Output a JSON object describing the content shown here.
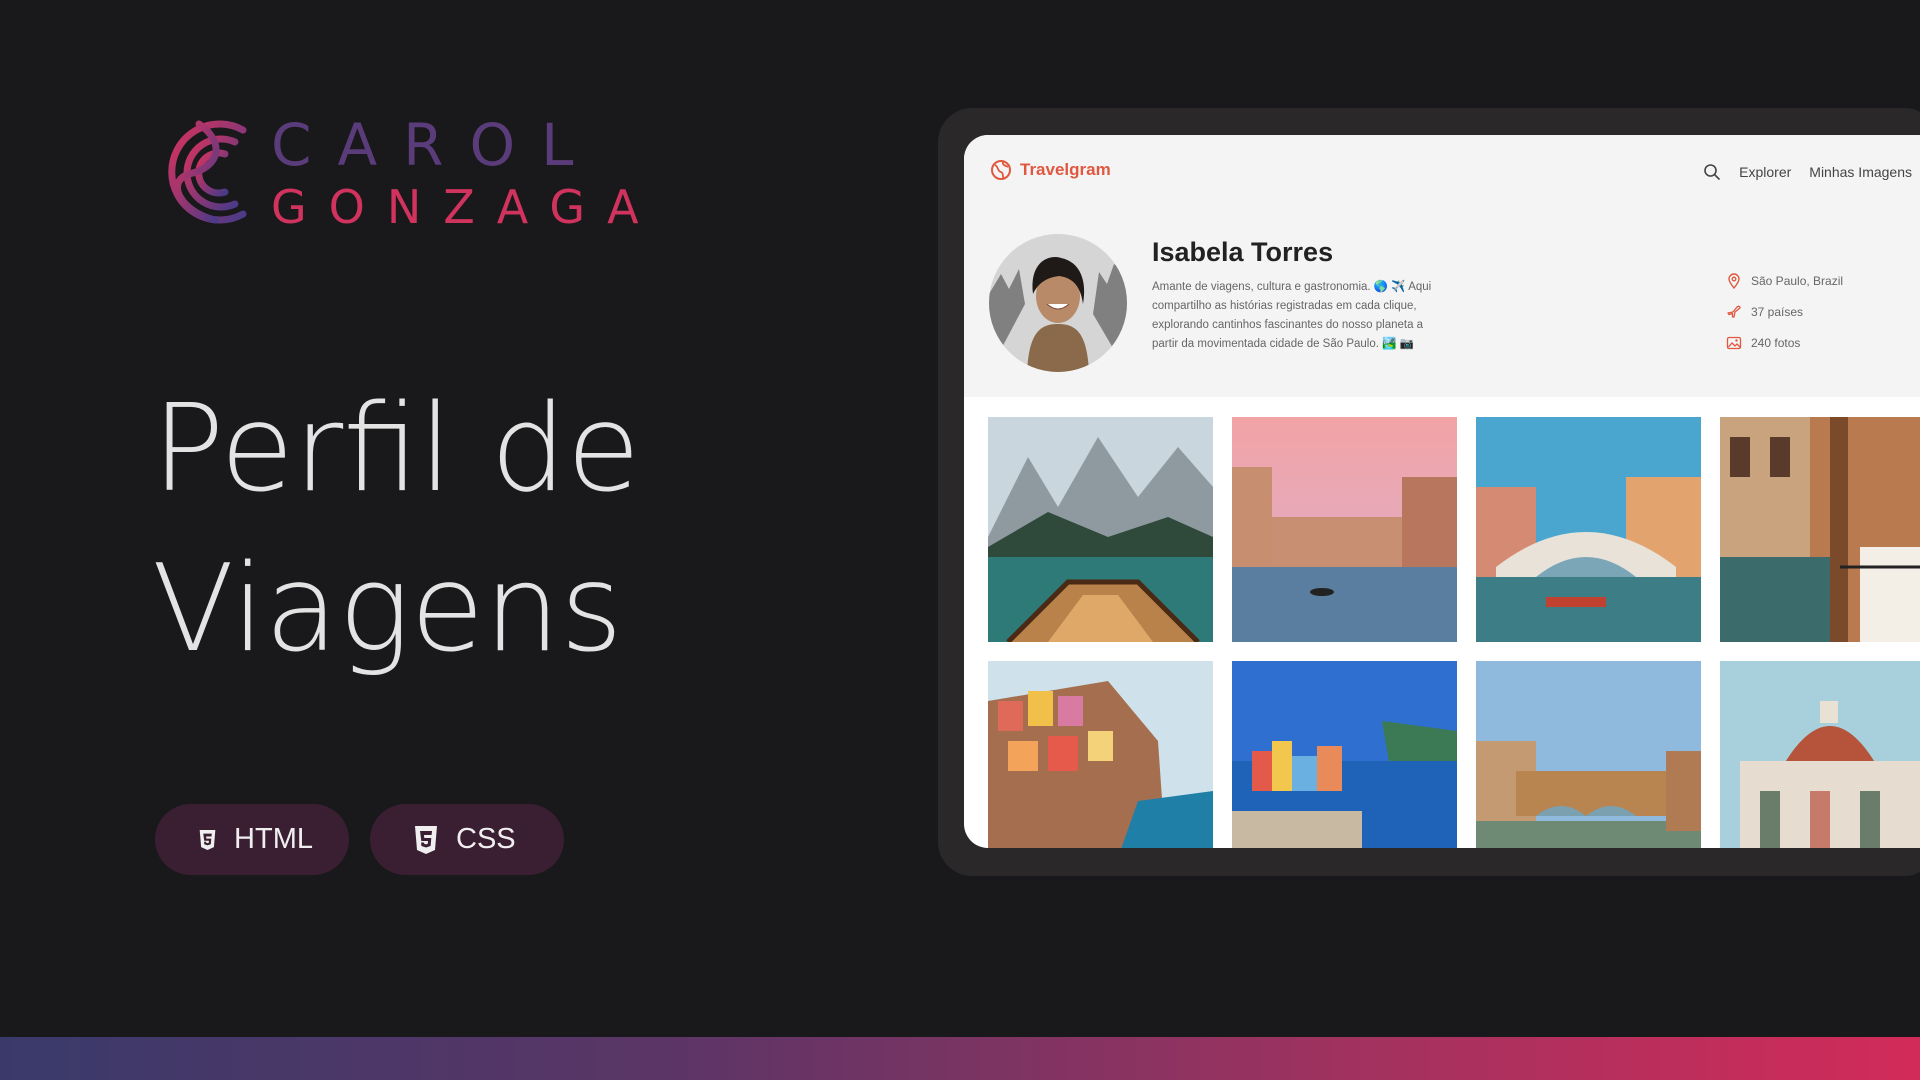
{
  "logo": {
    "line1": "CAROL",
    "line2": "GONZAGA"
  },
  "headline": {
    "line1": "Perfil de",
    "line2": "Viagens"
  },
  "tags": [
    {
      "label": "HTML",
      "icon": "html5-icon"
    },
    {
      "label": "CSS",
      "icon": "css3-icon"
    }
  ],
  "mockup": {
    "brand": "Travelgram",
    "nav": {
      "explore": "Explorer",
      "my_images": "Minhas Imagens"
    },
    "profile": {
      "name": "Isabela Torres",
      "bio": "Amante de viagens, cultura e gastronomia. 🌎 ✈️ Aqui compartilho as histórias registradas em cada clique, explorando cantinhos fascinantes do nosso planeta a partir da movimentada cidade de São Paulo. 🏞️ 📷",
      "location": "São Paulo, Brazil",
      "countries": "37 países",
      "photos": "240 fotos"
    },
    "gallery": [
      "lake-boat-mountains",
      "venice-canal-sunset",
      "rialto-bridge",
      "venice-cafe-terrace",
      "cinque-terre-cliff",
      "vernazza-coast",
      "ponte-vecchio",
      "florence-duomo"
    ]
  },
  "colors": {
    "background": "#19181b",
    "brand_orange": "#e0583f",
    "logo_purple": "#5a3c7b",
    "logo_pink": "#d0335d",
    "pill_bg": "#3a1f33"
  }
}
